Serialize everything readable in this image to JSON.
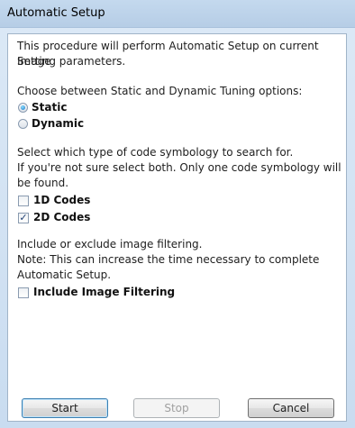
{
  "window": {
    "title": "Automatic Setup"
  },
  "intro": {
    "line1": "This procedure will perform Automatic Setup on current Image",
    "line2": "Setting parameters."
  },
  "tuning": {
    "prompt": "Choose between Static and Dynamic Tuning options:",
    "options": [
      {
        "label": "Static",
        "selected": true
      },
      {
        "label": "Dynamic",
        "selected": false
      }
    ]
  },
  "symbology": {
    "line1": "Select which type of code symbology to search for.",
    "line2": "If you're not sure select both. Only one code symbology will",
    "line3": "be found.",
    "options": [
      {
        "label": "1D Codes",
        "checked": false
      },
      {
        "label": "2D Codes",
        "checked": true
      }
    ]
  },
  "filtering": {
    "line1": "Include or exclude image filtering.",
    "line2": "Note: This can increase the time necessary to complete",
    "line3": "Automatic Setup.",
    "option": {
      "label": "Include Image Filtering",
      "checked": false
    }
  },
  "buttons": {
    "start": "Start",
    "stop": "Stop",
    "cancel": "Cancel"
  },
  "icons": {
    "check_glyph": "✓"
  }
}
